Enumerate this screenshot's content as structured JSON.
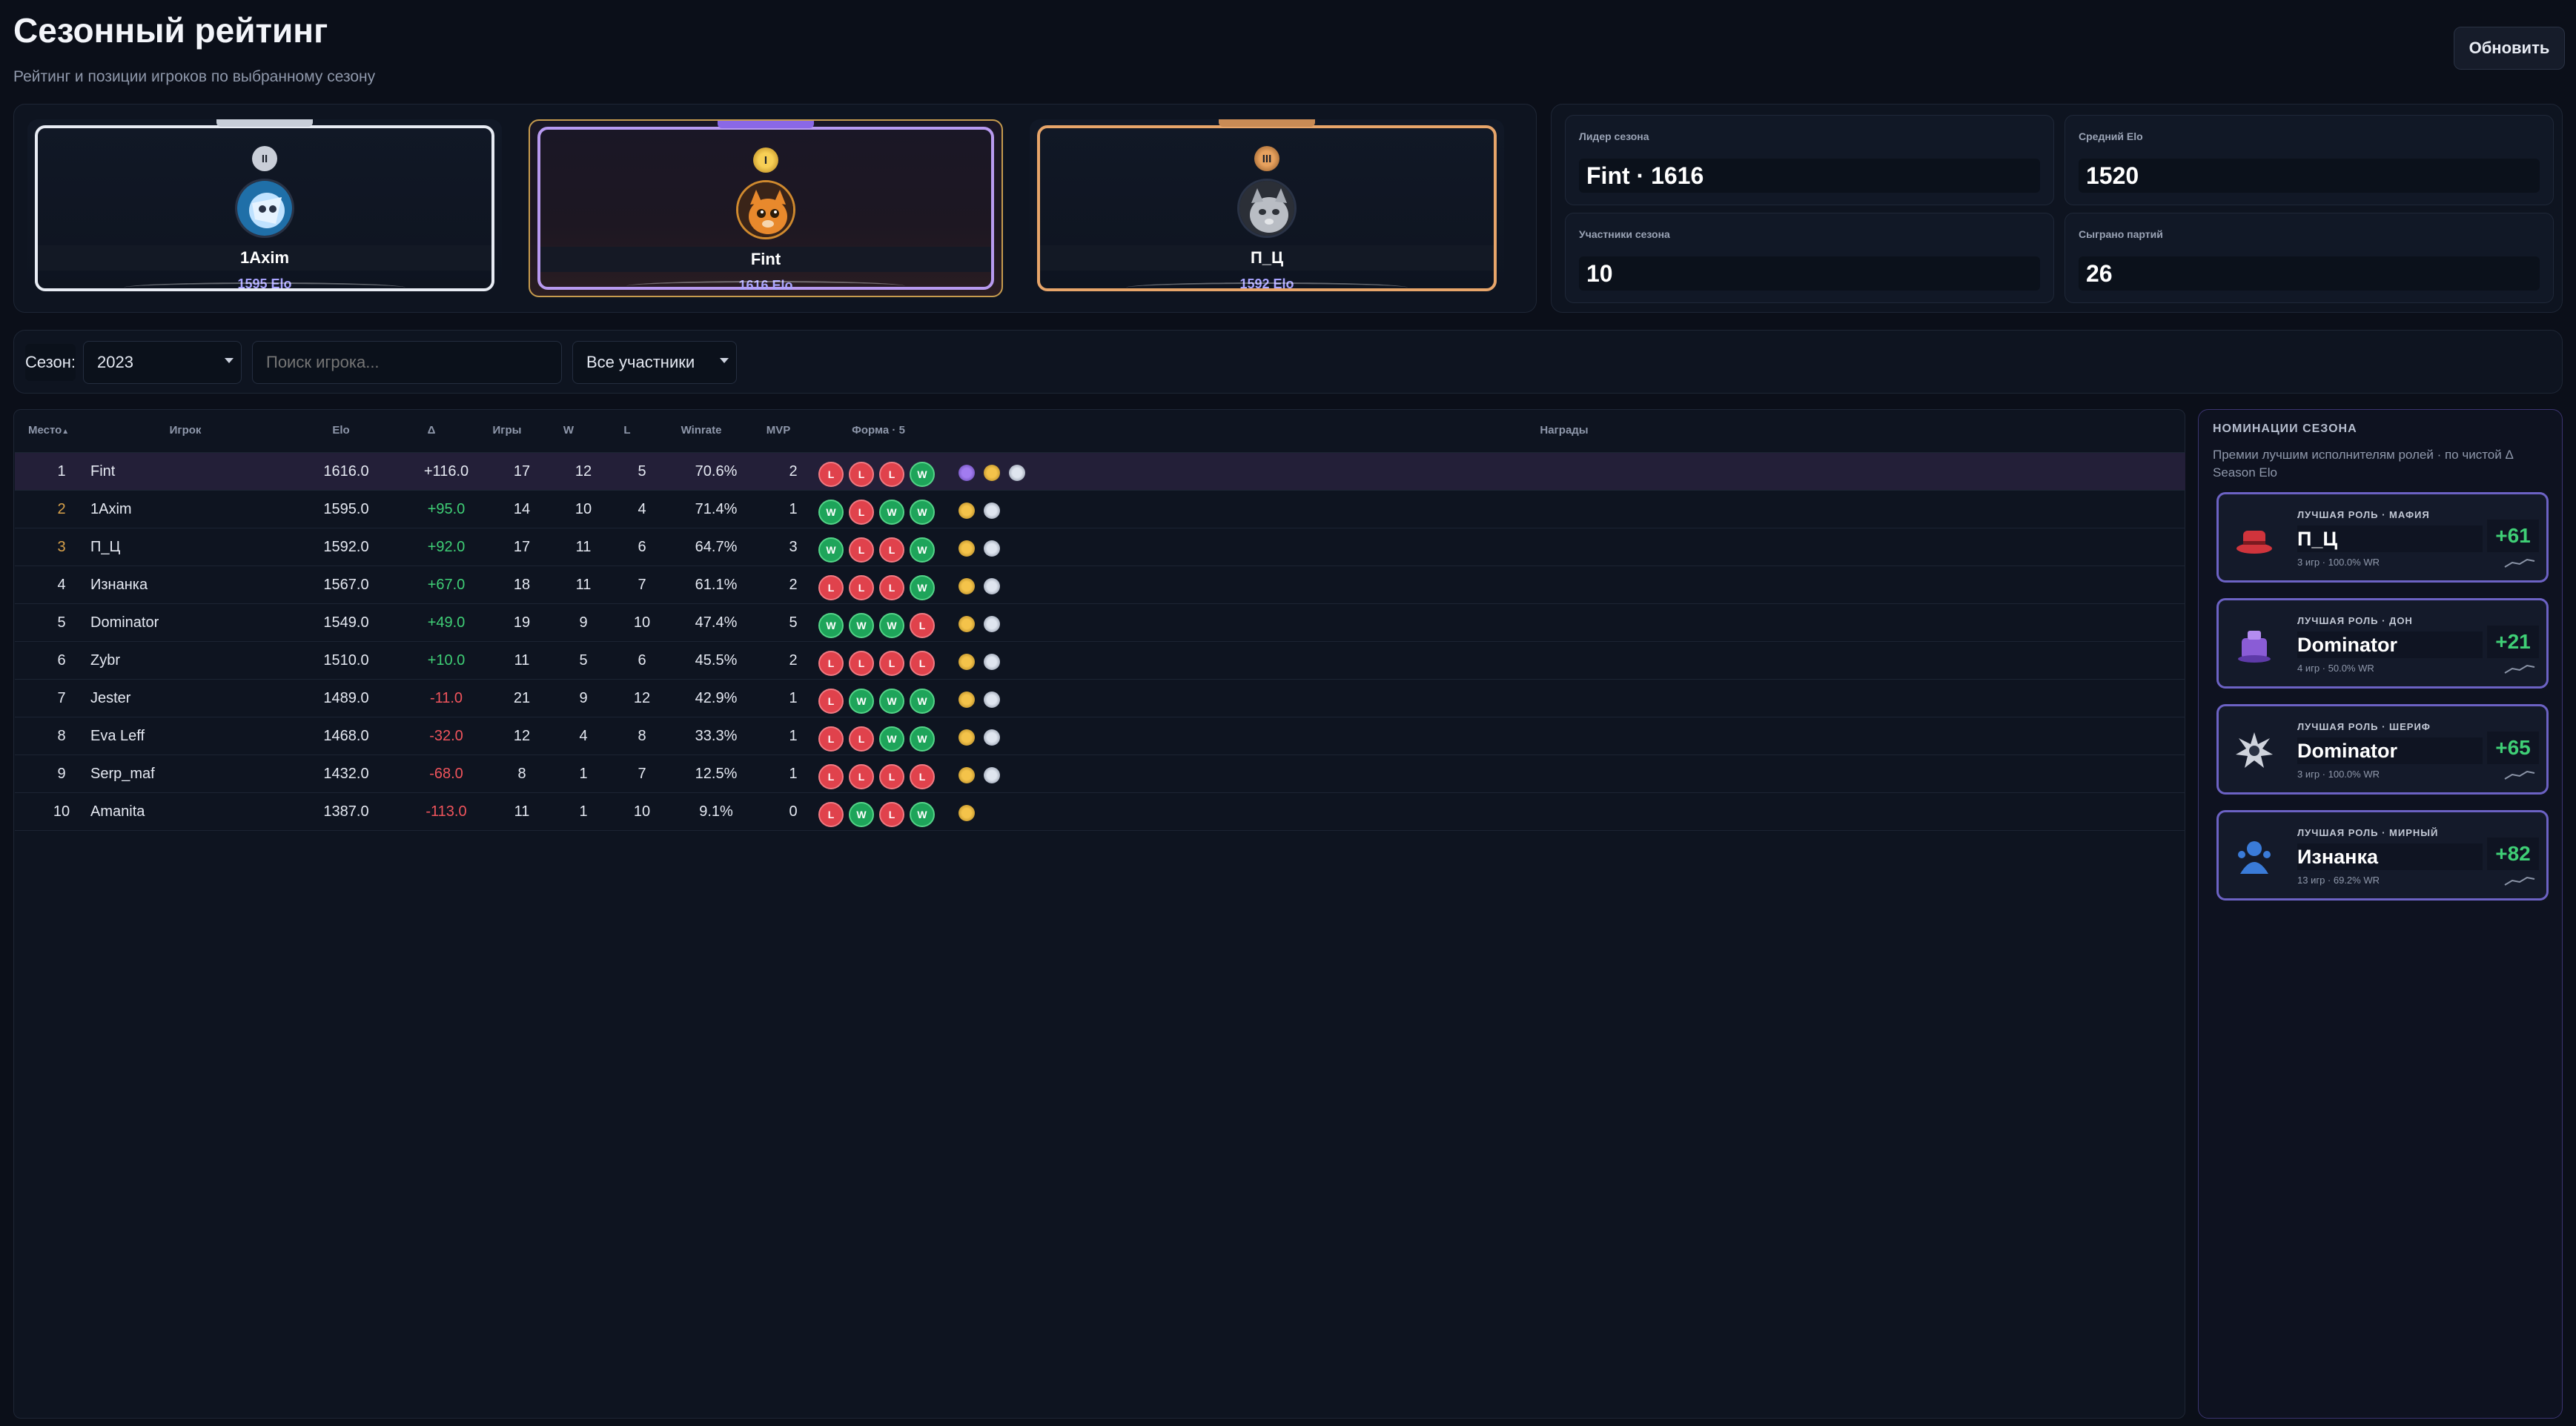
{
  "header": {
    "title": "Сезонный рейтинг",
    "subtitle": "Рейтинг и позиции игроков по выбранному сезону",
    "refresh_label": "Обновить"
  },
  "podium": [
    {
      "place": 2,
      "medal": "II",
      "name": "1Axim",
      "elo": "1595 Elo",
      "avatar_icon": "rick-avatar-icon"
    },
    {
      "place": 1,
      "medal": "I",
      "name": "Fint",
      "elo": "1616 Elo",
      "avatar_icon": "cat-avatar-icon"
    },
    {
      "place": 3,
      "medal": "III",
      "name": "П_Ц",
      "elo": "1592 Elo",
      "avatar_icon": "grey-cat-avatar-icon"
    }
  ],
  "stats": {
    "leader_label": "Лидер сезона",
    "leader_value": "Fint · 1616",
    "avg_label": "Средний Elo",
    "avg_value": "1520",
    "participants_label": "Участники сезона",
    "participants_value": "10",
    "games_label": "Сыграно партий",
    "games_value": "26"
  },
  "filters": {
    "season_label": "Сезон:",
    "season_value": "2023",
    "search_placeholder": "Поиск игрока...",
    "participants_value": "Все участники"
  },
  "table": {
    "columns": [
      "Место",
      "Игрок",
      "Elo",
      "Δ",
      "Игры",
      "W",
      "L",
      "Winrate",
      "MVP",
      "Форма · 5",
      "Награды"
    ],
    "rows": [
      {
        "place": "1",
        "player": "Fint",
        "elo": "1616.0",
        "delta": "+116.0",
        "games": "17",
        "w": "12",
        "l": "5",
        "winrate": "70.6%",
        "mvp": "2",
        "form": [
          "L",
          "L",
          "L",
          "W"
        ],
        "awards": [
          "purple",
          "gold",
          "silver"
        ]
      },
      {
        "place": "2",
        "player": "1Axim",
        "elo": "1595.0",
        "delta": "+95.0",
        "games": "14",
        "w": "10",
        "l": "4",
        "winrate": "71.4%",
        "mvp": "1",
        "form": [
          "W",
          "L",
          "W",
          "W"
        ],
        "awards": [
          "gold",
          "silver"
        ]
      },
      {
        "place": "3",
        "player": "П_Ц",
        "elo": "1592.0",
        "delta": "+92.0",
        "games": "17",
        "w": "11",
        "l": "6",
        "winrate": "64.7%",
        "mvp": "3",
        "form": [
          "W",
          "L",
          "L",
          "W"
        ],
        "awards": [
          "gold",
          "silver"
        ]
      },
      {
        "place": "4",
        "player": "Изнанка",
        "elo": "1567.0",
        "delta": "+67.0",
        "games": "18",
        "w": "11",
        "l": "7",
        "winrate": "61.1%",
        "mvp": "2",
        "form": [
          "L",
          "L",
          "L",
          "W"
        ],
        "awards": [
          "gold",
          "silver"
        ]
      },
      {
        "place": "5",
        "player": "Dominator",
        "elo": "1549.0",
        "delta": "+49.0",
        "games": "19",
        "w": "9",
        "l": "10",
        "winrate": "47.4%",
        "mvp": "5",
        "form": [
          "W",
          "W",
          "W",
          "L"
        ],
        "awards": [
          "gold",
          "silver"
        ]
      },
      {
        "place": "6",
        "player": "Zybr",
        "elo": "1510.0",
        "delta": "+10.0",
        "games": "11",
        "w": "5",
        "l": "6",
        "winrate": "45.5%",
        "mvp": "2",
        "form": [
          "L",
          "L",
          "L",
          "L"
        ],
        "awards": [
          "gold",
          "silver"
        ]
      },
      {
        "place": "7",
        "player": "Jester",
        "elo": "1489.0",
        "delta": "-11.0",
        "games": "21",
        "w": "9",
        "l": "12",
        "winrate": "42.9%",
        "mvp": "1",
        "form": [
          "L",
          "W",
          "W",
          "W"
        ],
        "awards": [
          "gold",
          "silver"
        ]
      },
      {
        "place": "8",
        "player": "Eva Leff",
        "elo": "1468.0",
        "delta": "-32.0",
        "games": "12",
        "w": "4",
        "l": "8",
        "winrate": "33.3%",
        "mvp": "1",
        "form": [
          "L",
          "L",
          "W",
          "W"
        ],
        "awards": [
          "gold",
          "silver"
        ]
      },
      {
        "place": "9",
        "player": "Serp_maf",
        "elo": "1432.0",
        "delta": "-68.0",
        "games": "8",
        "w": "1",
        "l": "7",
        "winrate": "12.5%",
        "mvp": "1",
        "form": [
          "L",
          "L",
          "L",
          "L"
        ],
        "awards": [
          "gold",
          "silver"
        ]
      },
      {
        "place": "10",
        "player": "Amanita",
        "elo": "1387.0",
        "delta": "-113.0",
        "games": "11",
        "w": "1",
        "l": "10",
        "winrate": "9.1%",
        "mvp": "0",
        "form": [
          "L",
          "W",
          "L",
          "W"
        ],
        "awards": [
          "gold"
        ]
      }
    ]
  },
  "nominations": {
    "title": "НОМИНАЦИИ СЕЗОНА",
    "subtitle": "Премии лучшим исполнителям ролей · по чистой Δ Season Elo",
    "items": [
      {
        "role": "ЛУЧШАЯ РОЛЬ · МАФИЯ",
        "name": "П_Ц",
        "meta": "3 игр · 100.0% WR",
        "delta": "+61",
        "icon": "mafia-hat-icon",
        "color": "#d0343c"
      },
      {
        "role": "ЛУЧШАЯ РОЛЬ · ДОН",
        "name": "Dominator",
        "meta": "4 игр · 50.0% WR",
        "delta": "+21",
        "icon": "don-hat-icon",
        "color": "#8a5cd6"
      },
      {
        "role": "ЛУЧШАЯ РОЛЬ · ШЕРИФ",
        "name": "Dominator",
        "meta": "3 игр · 100.0% WR",
        "delta": "+65",
        "icon": "sheriff-star-icon",
        "color": "#cfd3dc"
      },
      {
        "role": "ЛУЧШАЯ РОЛЬ · МИРНЫЙ",
        "name": "Изнанка",
        "meta": "13 игр · 69.2% WR",
        "delta": "+82",
        "icon": "civilian-icon",
        "color": "#3a7bd8"
      }
    ]
  }
}
